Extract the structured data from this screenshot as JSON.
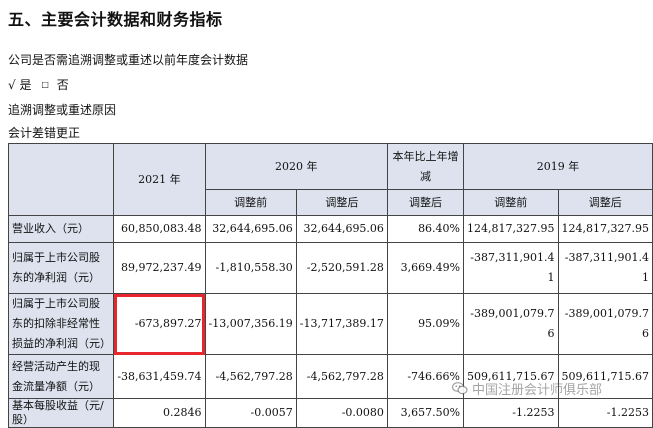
{
  "section_title": "五、主要会计数据和财务指标",
  "question": "公司是否需追溯调整或重述以前年度会计数据",
  "answer": {
    "yes_mark": "√",
    "yes": "是",
    "box": "□",
    "no": "否"
  },
  "reason_label": "追溯调整或重述原因",
  "reason_value": "会计差错更正",
  "table": {
    "header": {
      "col_2021": "2021 年",
      "col_2020": "2020 年",
      "col_change": "本年比上年增减",
      "col_2019": "2019 年",
      "sub_before": "调整前",
      "sub_after": "调整后"
    },
    "rows": [
      {
        "label": "营业收入（元）",
        "v2021": "60,850,083.48",
        "v2020_before": "32,644,695.06",
        "v2020_after": "32,644,695.06",
        "change": "86.40%",
        "v2019_before": "124,817,327.95",
        "v2019_after": "124,817,327.95"
      },
      {
        "label": "归属于上市公司股东的净利润（元）",
        "v2021": "89,972,237.49",
        "v2020_before": "-1,810,558.30",
        "v2020_after": "-2,520,591.28",
        "change": "3,669.49%",
        "v2019_before": "-387,311,901.41",
        "v2019_after": "-387,311,901.41"
      },
      {
        "label": "归属于上市公司股东的扣除非经常性损益的净利润（元）",
        "v2021": "-673,897.27",
        "v2020_before": "-13,007,356.19",
        "v2020_after": "-13,717,389.17",
        "change": "95.09%",
        "v2019_before": "-389,001,079.76",
        "v2019_after": "-389,001,079.76"
      },
      {
        "label": "经营活动产生的现金流量净额（元）",
        "v2021": "-38,631,459.74",
        "v2020_before": "-4,562,797.28",
        "v2020_after": "-4,562,797.28",
        "change": "-746.66%",
        "v2019_before": "509,611,715.67",
        "v2019_after": "509,611,715.67"
      },
      {
        "label": "基本每股收益（元/股）",
        "v2021": "0.2846",
        "v2020_before": "-0.0057",
        "v2020_after": "-0.0080",
        "change": "3,657.50%",
        "v2019_before": "-1.2253",
        "v2019_after": "-1.2253"
      }
    ]
  },
  "watermark": {
    "text": "中国注册会计师俱乐部",
    "icon": "wechat-icon"
  },
  "colors": {
    "header_bg": "#dde2ee",
    "highlight": "#e8262d",
    "border": "#444444"
  }
}
